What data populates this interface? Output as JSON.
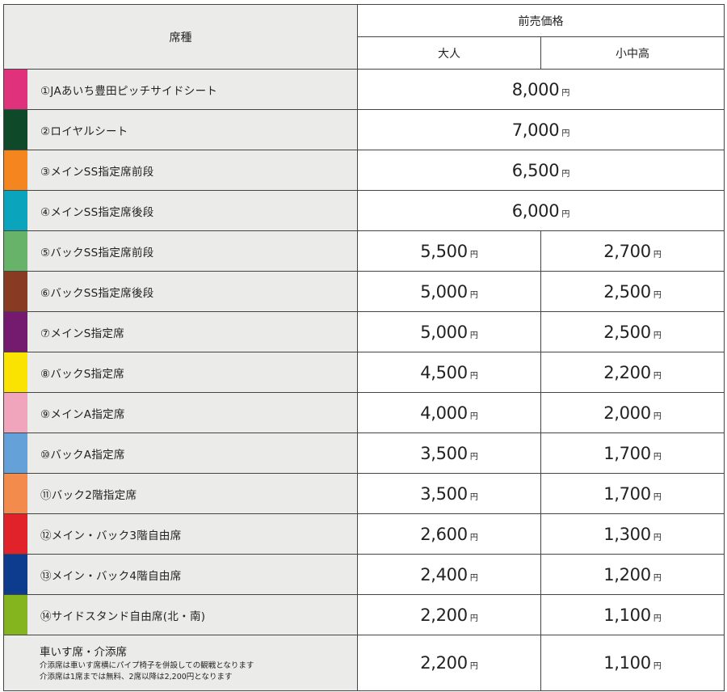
{
  "header": {
    "seat_type": "席種",
    "presale_price": "前売価格",
    "adult": "大人",
    "student": "小中高"
  },
  "yen": "円",
  "rows": [
    {
      "label": "①JAあいち豊田ピッチサイドシート",
      "color": "#e0327c",
      "merged": "8,000"
    },
    {
      "label": "②ロイヤルシート",
      "color": "#0e4a2a",
      "merged": "7,000"
    },
    {
      "label": "③メインSS指定席前段",
      "color": "#f5861f",
      "merged": "6,500"
    },
    {
      "label": "④メインSS指定席後段",
      "color": "#0aa5bd",
      "merged": "6,000"
    },
    {
      "label": "⑤バックSS指定席前段",
      "color": "#67b36a",
      "adult": "5,500",
      "student": "2,700"
    },
    {
      "label": "⑥バックSS指定席後段",
      "color": "#883a22",
      "adult": "5,000",
      "student": "2,500"
    },
    {
      "label": "⑦メインS指定席",
      "color": "#741a6f",
      "adult": "5,000",
      "student": "2,500"
    },
    {
      "label": "⑧バックS指定席",
      "color": "#fae300",
      "adult": "4,500",
      "student": "2,200"
    },
    {
      "label": "⑨メインA指定席",
      "color": "#f0a5bd",
      "adult": "4,000",
      "student": "2,000"
    },
    {
      "label": "⑩バックA指定席",
      "color": "#63a1d8",
      "adult": "3,500",
      "student": "1,700"
    },
    {
      "label": "⑪バック2階指定席",
      "color": "#f28b4c",
      "adult": "3,500",
      "student": "1,700"
    },
    {
      "label": "⑫メイン・バック3階自由席",
      "color": "#e2222a",
      "adult": "2,600",
      "student": "1,300"
    },
    {
      "label": "⑬メイン・バック4階自由席",
      "color": "#0d3b8e",
      "adult": "2,400",
      "student": "1,200"
    },
    {
      "label": "⑭サイドスタンド自由席(北・南)",
      "color": "#84b51f",
      "adult": "2,200",
      "student": "1,100"
    }
  ],
  "wheelchair": {
    "title": "車いす席・介添席",
    "note1": "介添席は車いす席横にパイプ椅子を併設しての観戦となります",
    "note2": "介添席は1席までは無料、2席以降は2,200円となります",
    "adult": "2,200",
    "student": "1,100"
  }
}
